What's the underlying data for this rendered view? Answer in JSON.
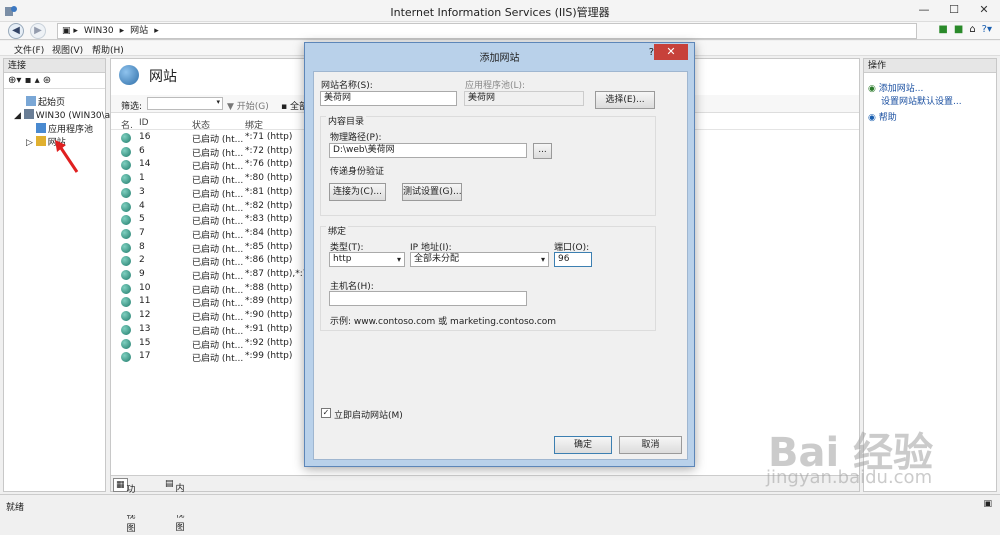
{
  "window": {
    "title": "Internet Information Services (IIS)管理器",
    "controls": {
      "minimize": "—",
      "maximize": "☐",
      "close": "✕"
    }
  },
  "address": {
    "crumbs": [
      "WIN30",
      "网站"
    ]
  },
  "menu": {
    "file": "文件(F)",
    "view": "视图(V)",
    "help": "帮助(H)"
  },
  "left_pane": {
    "header": "连接",
    "tree": [
      "起始页",
      "WIN30 (WIN30\\ad",
      "应用程序池",
      "网站"
    ]
  },
  "center": {
    "title": "网站",
    "filter_label": "筛选:",
    "start_btn": "开始(G)",
    "all_btn": "全部",
    "columns": {
      "name": "名.",
      "id": "ID",
      "status": "状态",
      "binding": "绑定"
    },
    "rows": [
      {
        "id": "16",
        "status": "已启动 (ht...",
        "binding": "*:71 (http)"
      },
      {
        "id": "6",
        "status": "已启动 (ht...",
        "binding": "*:72 (http)"
      },
      {
        "id": "14",
        "status": "已启动 (ht...",
        "binding": "*:76 (http)"
      },
      {
        "id": "1",
        "status": "已启动 (ht...",
        "binding": "*:80 (http)"
      },
      {
        "id": "3",
        "status": "已启动 (ht...",
        "binding": "*:81 (http)"
      },
      {
        "id": "4",
        "status": "已启动 (ht...",
        "binding": "*:82 (http)"
      },
      {
        "id": "5",
        "status": "已启动 (ht...",
        "binding": "*:83 (http)"
      },
      {
        "id": "7",
        "status": "已启动 (ht...",
        "binding": "*:84 (http)"
      },
      {
        "id": "8",
        "status": "已启动 (ht...",
        "binding": "*:85 (http)"
      },
      {
        "id": "2",
        "status": "已启动 (ht...",
        "binding": "*:86 (http)"
      },
      {
        "id": "9",
        "status": "已启动 (ht...",
        "binding": "*:87 (http),*:78 ("
      },
      {
        "id": "10",
        "status": "已启动 (ht...",
        "binding": "*:88 (http)"
      },
      {
        "id": "11",
        "status": "已启动 (ht...",
        "binding": "*:89 (http)"
      },
      {
        "id": "12",
        "status": "已启动 (ht...",
        "binding": "*:90 (http)"
      },
      {
        "id": "13",
        "status": "已启动 (ht...",
        "binding": "*:91 (http)"
      },
      {
        "id": "15",
        "status": "已启动 (ht...",
        "binding": "*:92 (http)"
      },
      {
        "id": "17",
        "status": "已启动 (ht...",
        "binding": "*:99 (http)"
      }
    ],
    "tab_features": "功能视图",
    "tab_content": "内容视图"
  },
  "right_pane": {
    "header": "操作",
    "actions": [
      "添加网站...",
      "设置网站默认设置...",
      "帮助"
    ]
  },
  "status": {
    "text": "就绪"
  },
  "dialog": {
    "title": "添加网站",
    "help": "?",
    "site_name_label": "网站名称(S):",
    "site_name_value": "美荷网",
    "app_pool_label": "应用程序池(L):",
    "app_pool_value": "美荷网",
    "select_btn": "选择(E)...",
    "content_dir_label": "内容目录",
    "physical_path_label": "物理路径(P):",
    "physical_path_value": "D:\\web\\美荷网",
    "browse_btn": "...",
    "passthrough_label": "传递身份验证",
    "connect_as_btn": "连接为(C)...",
    "test_settings_btn": "测试设置(G)...",
    "binding_label": "绑定",
    "type_label": "类型(T):",
    "type_value": "http",
    "ip_label": "IP 地址(I):",
    "ip_value": "全部未分配",
    "port_label": "端口(O):",
    "port_value": "96",
    "host_label": "主机名(H):",
    "host_value": "",
    "example_text": "示例: www.contoso.com 或 marketing.contoso.com",
    "start_now_label": "立即启动网站(M)",
    "start_now_checked": true,
    "ok_btn": "确定",
    "cancel_btn": "取消"
  },
  "watermark": {
    "brand": "Bai 经验",
    "url": "jingyan.baidu.com"
  }
}
